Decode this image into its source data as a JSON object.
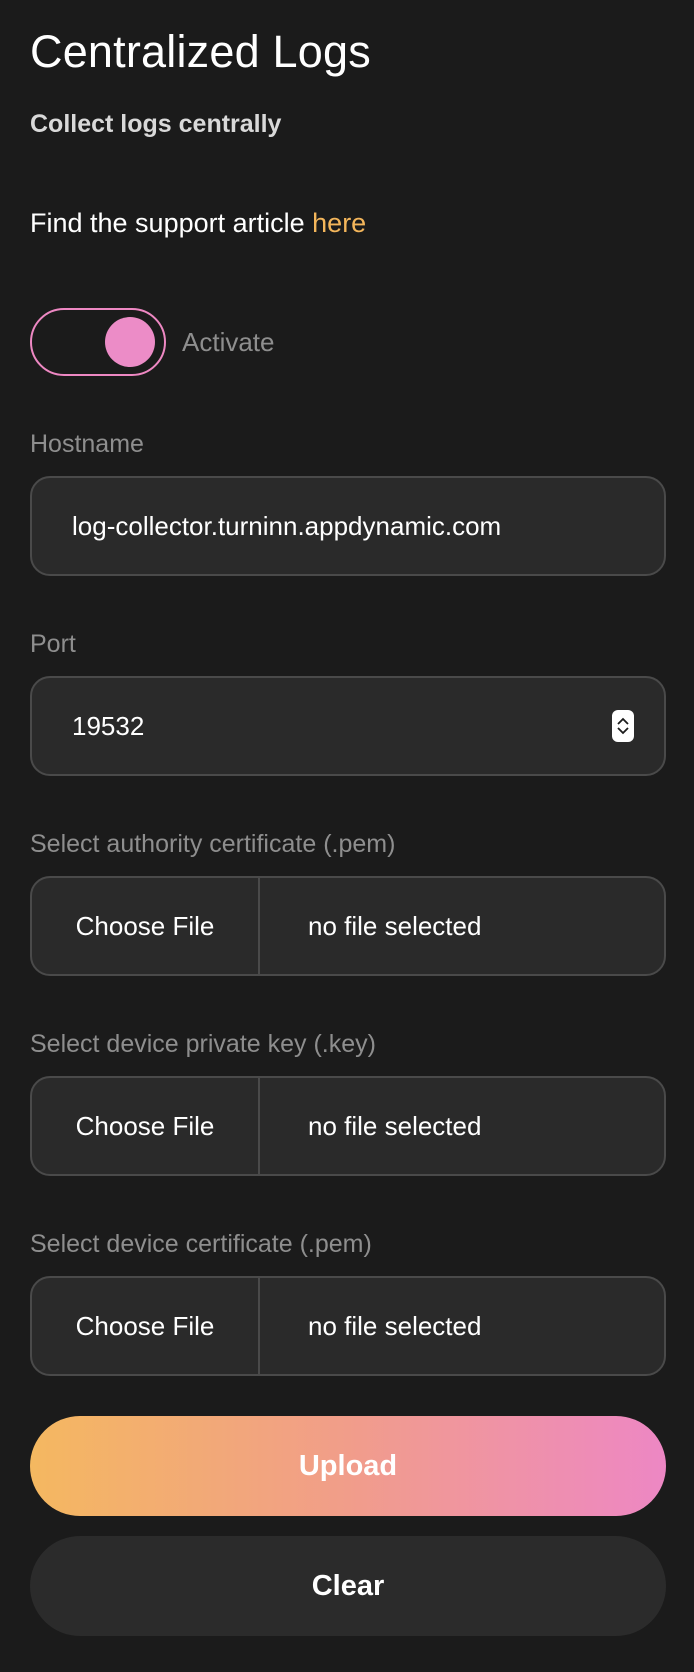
{
  "header": {
    "title": "Centralized Logs",
    "subtitle": "Collect logs centrally"
  },
  "support": {
    "text": "Find the support article ",
    "link_label": "here"
  },
  "activate": {
    "label": "Activate",
    "enabled": true
  },
  "hostname": {
    "label": "Hostname",
    "value": "log-collector.turninn.appdynamic.com"
  },
  "port": {
    "label": "Port",
    "value": "19532"
  },
  "files": [
    {
      "label": "Select authority certificate (.pem)",
      "button_label": "Choose File",
      "status": "no file selected"
    },
    {
      "label": "Select device private key (.key)",
      "button_label": "Choose File",
      "status": "no file selected"
    },
    {
      "label": "Select device certificate (.pem)",
      "button_label": "Choose File",
      "status": "no file selected"
    }
  ],
  "actions": {
    "upload_label": "Upload",
    "clear_label": "Clear"
  },
  "colors": {
    "background": "#1b1b1b",
    "accent_link": "#f4b65b",
    "accent_pink": "#ed87c4",
    "field_bg": "#2a2a2a"
  }
}
